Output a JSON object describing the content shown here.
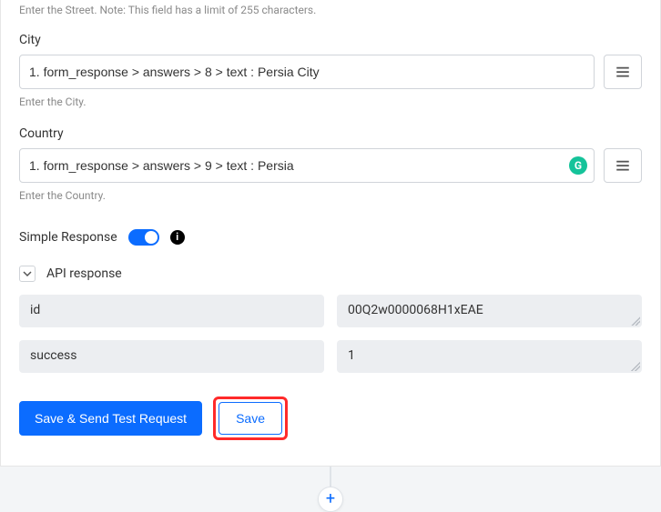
{
  "topHelper": "Enter the Street. Note: This field has a limit of 255 characters.",
  "fields": {
    "city": {
      "label": "City",
      "value": "1. form_response > answers > 8 > text : Persia City",
      "helper": "Enter the City."
    },
    "country": {
      "label": "Country",
      "value": "1. form_response > answers > 9 > text : Persia",
      "helper": "Enter the Country."
    }
  },
  "simpleResponse": {
    "label": "Simple Response",
    "enabled": true
  },
  "apiResponse": {
    "title": "API response",
    "rows": [
      {
        "key": "id",
        "value": "00Q2w0000068H1xEAE"
      },
      {
        "key": "success",
        "value": "1"
      }
    ]
  },
  "buttons": {
    "saveSend": "Save & Send Test Request",
    "save": "Save"
  },
  "icons": {
    "grammarly": "G",
    "info": "i",
    "add": "+"
  }
}
